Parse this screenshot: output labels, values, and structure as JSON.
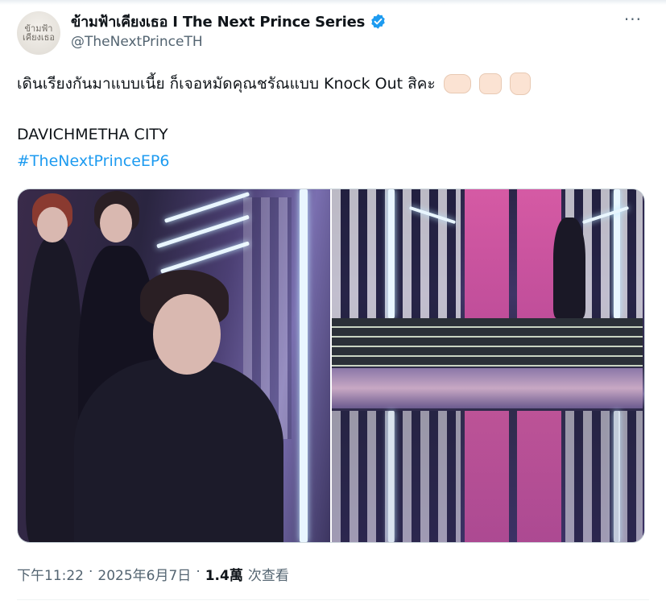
{
  "tweet": {
    "avatar_text": "ข้ามฟ้า เคียงเธอ",
    "display_name": "ข้ามฟ้าเคียงเธอ I The Next Prince Series",
    "handle": "@TheNextPrinceTH",
    "more_label": "···",
    "verified_icon": "verified-badge-icon",
    "body_line1": "เดินเรียงกันมาแบบเนี้ย ก็เจอหมัดคุณชรัณแบบ Knock Out สิคะ",
    "emojis": [
      "fist-right-icon",
      "fist-front-icon",
      "raised-fist-icon"
    ],
    "body_line2": "DAVICHMETHA CITY",
    "hashtag": "#TheNextPrinceEP6",
    "time": "下午11:22",
    "sep1": "·",
    "date": "2025年6月7日",
    "sep2": "·",
    "views_count": "1.4萬",
    "views_label": "次查看"
  },
  "colors": {
    "link": "#1d9bf0",
    "verified": "#1d9bf0",
    "secondary_text": "#536471"
  }
}
